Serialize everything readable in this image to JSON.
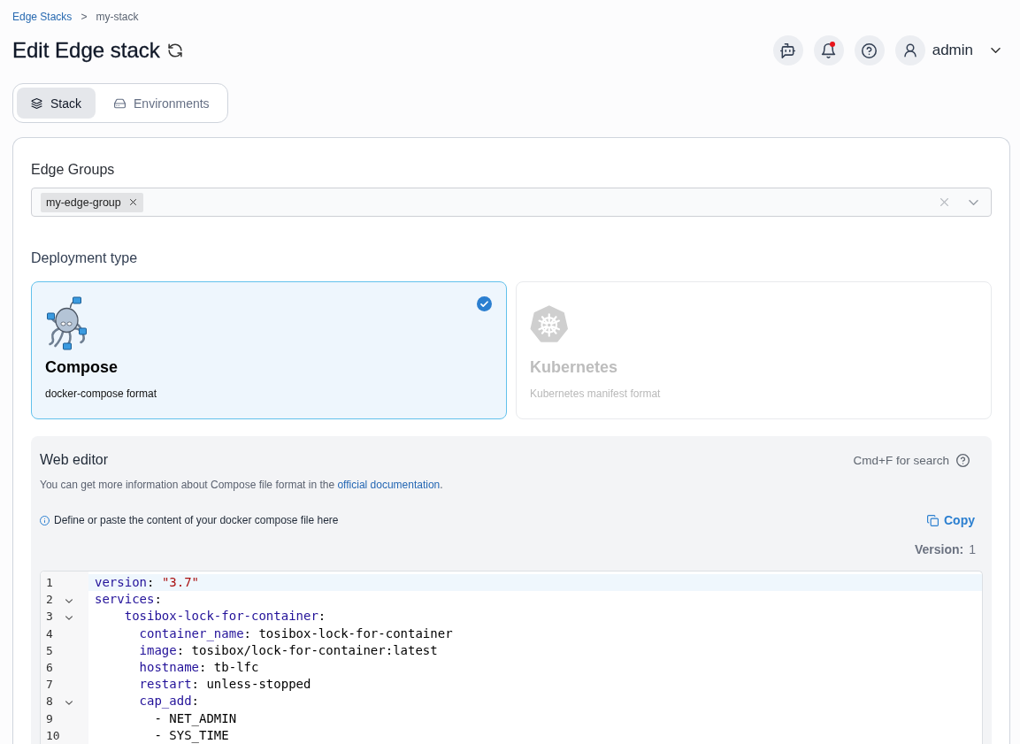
{
  "breadcrumbs": {
    "separator": ">",
    "items": [
      {
        "label": "Edge Stacks",
        "link": true
      },
      {
        "label": "my-stack",
        "link": false
      }
    ]
  },
  "page": {
    "title": "Edit Edge stack"
  },
  "notifications": {
    "unread": true
  },
  "user": {
    "name": "admin"
  },
  "tabs": [
    {
      "label": "Stack",
      "selected": true
    },
    {
      "label": "Environments",
      "selected": false
    }
  ],
  "edge_groups": {
    "label": "Edge Groups",
    "tags": [
      "my-edge-group"
    ]
  },
  "deployment_type": {
    "label": "Deployment type",
    "options": [
      {
        "kind": "compose",
        "title": "Compose",
        "description": "docker-compose format",
        "selected": true,
        "disabled": false
      },
      {
        "kind": "kubernetes",
        "title": "Kubernetes",
        "description": "Kubernetes manifest format",
        "selected": false,
        "disabled": true
      }
    ]
  },
  "web_editor": {
    "title": "Web editor",
    "search_hint": "Cmd+F for search",
    "description": {
      "text": "You can get more information about Compose file format in the",
      "link": "official documentation",
      "suffix": "."
    },
    "hint": "Define or paste the content of your docker compose file here",
    "copy_button": "Copy",
    "version": {
      "label": "Version:",
      "value": "1"
    },
    "lines": [
      {
        "number": "1",
        "foldable": false,
        "active": true,
        "tokens": [
          {
            "kind": "key",
            "text": "version"
          },
          {
            "kind": "plain",
            "text": ": "
          },
          {
            "kind": "string",
            "text": "\"3.7\""
          }
        ]
      },
      {
        "number": "2",
        "foldable": true,
        "active": false,
        "tokens": [
          {
            "kind": "key",
            "text": "services"
          },
          {
            "kind": "plain",
            "text": ":"
          }
        ]
      },
      {
        "number": "3",
        "foldable": true,
        "active": false,
        "tokens": [
          {
            "kind": "key",
            "text": "    tosibox-lock-for-container"
          },
          {
            "kind": "plain",
            "text": ":"
          }
        ]
      },
      {
        "number": "4",
        "foldable": false,
        "active": false,
        "tokens": [
          {
            "kind": "key",
            "text": "      container_name"
          },
          {
            "kind": "plain",
            "text": ": tosibox-lock-for-container"
          }
        ]
      },
      {
        "number": "5",
        "foldable": false,
        "active": false,
        "tokens": [
          {
            "kind": "key",
            "text": "      image"
          },
          {
            "kind": "plain",
            "text": ": tosibox/lock-for-container:latest"
          }
        ]
      },
      {
        "number": "6",
        "foldable": false,
        "active": false,
        "tokens": [
          {
            "kind": "key",
            "text": "      hostname"
          },
          {
            "kind": "plain",
            "text": ": tb-lfc"
          }
        ]
      },
      {
        "number": "7",
        "foldable": false,
        "active": false,
        "tokens": [
          {
            "kind": "key",
            "text": "      restart"
          },
          {
            "kind": "plain",
            "text": ": unless-stopped"
          }
        ]
      },
      {
        "number": "8",
        "foldable": true,
        "active": false,
        "tokens": [
          {
            "kind": "key",
            "text": "      cap_add"
          },
          {
            "kind": "plain",
            "text": ":"
          }
        ]
      },
      {
        "number": "9",
        "foldable": false,
        "active": false,
        "tokens": [
          {
            "kind": "plain",
            "text": "        - NET_ADMIN"
          }
        ]
      },
      {
        "number": "10",
        "foldable": false,
        "active": false,
        "tokens": [
          {
            "kind": "plain",
            "text": "        - SYS_TIME"
          }
        ]
      }
    ]
  }
}
